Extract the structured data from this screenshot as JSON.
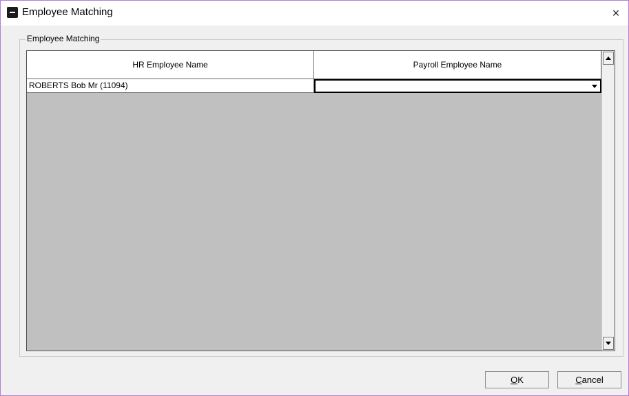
{
  "window": {
    "title": "Employee Matching",
    "close_label": "×"
  },
  "groupbox": {
    "label": "Employee Matching"
  },
  "grid": {
    "columns": [
      "HR Employee Name",
      "Payroll Employee Name"
    ],
    "rows": [
      {
        "hr_name": "ROBERTS Bob Mr (11094)",
        "payroll_name": ""
      }
    ]
  },
  "buttons": {
    "ok": {
      "mnemonic": "O",
      "rest": "K"
    },
    "cancel": {
      "mnemonic": "C",
      "rest": "ancel"
    }
  }
}
